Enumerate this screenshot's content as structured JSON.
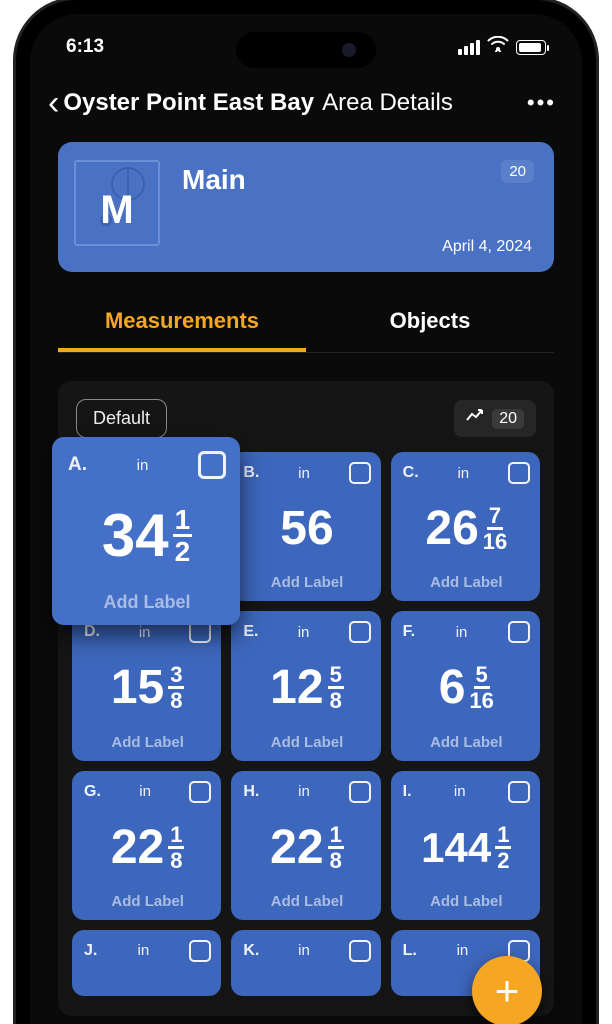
{
  "status": {
    "time": "6:13"
  },
  "nav": {
    "back_title": "Oyster Point East Bay",
    "page_title": "Area Details"
  },
  "area": {
    "initial": "M",
    "name": "Main",
    "count": "20",
    "date": "April 4, 2024"
  },
  "tabs": {
    "measurements": "Measurements",
    "objects": "Objects"
  },
  "panel": {
    "default_label": "Default",
    "stats_count": "20",
    "add_label": "Add Label",
    "unit": "in"
  },
  "measurements": [
    {
      "letter": "A.",
      "whole": "34",
      "num": "1",
      "den": "2"
    },
    {
      "letter": "B.",
      "whole": "56",
      "num": "",
      "den": ""
    },
    {
      "letter": "C.",
      "whole": "26",
      "num": "7",
      "den": "16"
    },
    {
      "letter": "D.",
      "whole": "15",
      "num": "3",
      "den": "8"
    },
    {
      "letter": "E.",
      "whole": "12",
      "num": "5",
      "den": "8"
    },
    {
      "letter": "F.",
      "whole": "6",
      "num": "5",
      "den": "16"
    },
    {
      "letter": "G.",
      "whole": "22",
      "num": "1",
      "den": "8"
    },
    {
      "letter": "H.",
      "whole": "22",
      "num": "1",
      "den": "8"
    },
    {
      "letter": "I.",
      "whole": "144",
      "num": "1",
      "den": "2"
    },
    {
      "letter": "J.",
      "whole": "",
      "num": "",
      "den": ""
    },
    {
      "letter": "K.",
      "whole": "",
      "num": "",
      "den": ""
    },
    {
      "letter": "L.",
      "whole": "",
      "num": "",
      "den": ""
    }
  ],
  "fab": {
    "plus": "+"
  }
}
